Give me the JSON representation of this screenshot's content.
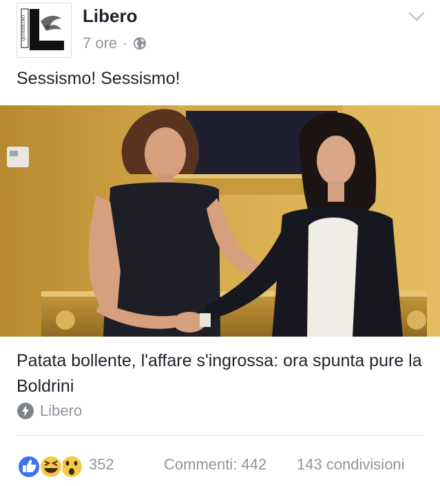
{
  "post": {
    "page_name": "Libero",
    "time": "7 ore",
    "separator": "·",
    "audience_icon": "globe-icon",
    "text": "Sessismo! Sessismo!",
    "logo_text": "QUOTIDIANO"
  },
  "link": {
    "title": "Patata bollente, l'affare s'ingrossa: ora spunta pure la Boldrini",
    "source": "Libero",
    "source_icon": "lightning-icon"
  },
  "engagement": {
    "reaction_icons": [
      "like-icon",
      "laugh-icon",
      "wow-icon"
    ],
    "reaction_count": "352",
    "comments": "Commenti: 442",
    "shares": "143 condivisioni"
  },
  "colors": {
    "text": "#1d2129",
    "muted": "#90949c",
    "like_blue": "#3b73e8",
    "emoji_yellow": "#f7c94a",
    "divider": "#dddfe2"
  }
}
